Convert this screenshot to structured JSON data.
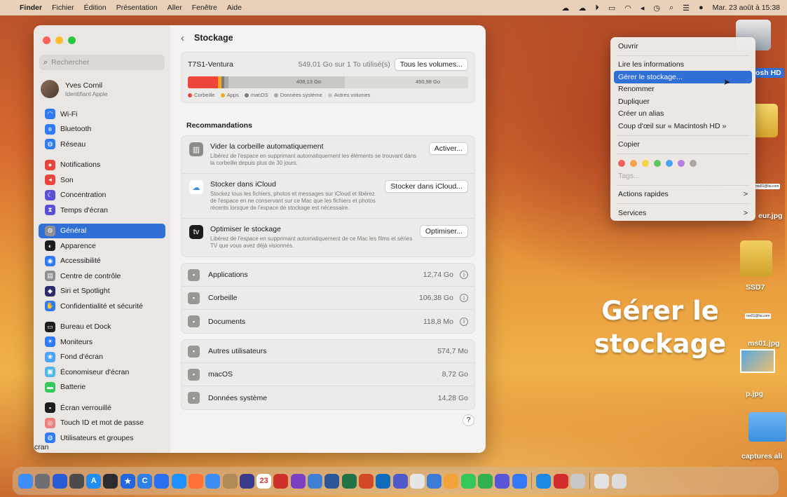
{
  "menubar": {
    "items": [
      "Finder",
      "Fichier",
      "Édition",
      "Présentation",
      "Aller",
      "Fenêtre",
      "Aide"
    ],
    "clock": "Mar. 23 août à 15:38"
  },
  "sidebar": {
    "search_placeholder": "Rechercher",
    "account_name": "Yves Cornil",
    "account_sub": "Identifiant Apple",
    "groups": [
      [
        {
          "label": "Wi-Fi",
          "color": "#2f7bf5",
          "icon": "wifi-icon"
        },
        {
          "label": "Bluetooth",
          "color": "#2f7bf5",
          "icon": "bluetooth-icon"
        },
        {
          "label": "Réseau",
          "color": "#2f7bf5",
          "icon": "globe-icon"
        }
      ],
      [
        {
          "label": "Notifications",
          "color": "#e8453c",
          "icon": "bell-icon"
        },
        {
          "label": "Son",
          "color": "#e8453c",
          "icon": "speaker-icon"
        },
        {
          "label": "Concentration",
          "color": "#5b4fd6",
          "icon": "moon-icon"
        },
        {
          "label": "Temps d'écran",
          "color": "#5b4fd6",
          "icon": "hourglass-icon"
        }
      ],
      [
        {
          "label": "Général",
          "color": "#8e8e93",
          "icon": "gear-icon"
        },
        {
          "label": "Apparence",
          "color": "#1d1d1f",
          "icon": "appearance-icon"
        },
        {
          "label": "Accessibilité",
          "color": "#2f7bf5",
          "icon": "accessibility-icon"
        },
        {
          "label": "Centre de contrôle",
          "color": "#8e8e93",
          "icon": "control-center-icon"
        },
        {
          "label": "Siri et Spotlight",
          "color": "#2b2b6e",
          "icon": "siri-icon"
        },
        {
          "label": "Confidentialité et sécurité",
          "color": "#2f7bf5",
          "icon": "hand-icon"
        }
      ],
      [
        {
          "label": "Bureau et Dock",
          "color": "#1d1d1f",
          "icon": "dock-icon"
        },
        {
          "label": "Moniteurs",
          "color": "#2f7bf5",
          "icon": "sun-icon"
        },
        {
          "label": "Fond d'écran",
          "color": "#4fa3f7",
          "icon": "wallpaper-icon"
        },
        {
          "label": "Économiseur d'écran",
          "color": "#52b6e8",
          "icon": "screensaver-icon"
        },
        {
          "label": "Batterie",
          "color": "#34c759",
          "icon": "battery-icon"
        }
      ],
      [
        {
          "label": "Écran verrouillé",
          "color": "#1d1d1f",
          "icon": "lock-icon"
        },
        {
          "label": "Touch ID et mot de passe",
          "color": "#f08080",
          "icon": "fingerprint-icon"
        },
        {
          "label": "Utilisateurs et groupes",
          "color": "#2f7bf5",
          "icon": "users-icon"
        }
      ]
    ],
    "selected": "Général",
    "fragment": "cran"
  },
  "main": {
    "title": "Stockage",
    "volume": {
      "name": "T7S1-Ventura",
      "usage": "549,01 Go sur 1 To utilisé(s)",
      "all_button": "Tous les volumes...",
      "bar_used_label": "406,13 Go",
      "bar_free_label": "450,98 Go",
      "segments": [
        {
          "name": "Corbeille",
          "color": "#f0453a",
          "fraction": 0.106
        },
        {
          "name": "Apps",
          "color": "#f5a623",
          "fraction": 0.013
        },
        {
          "name": "macOS",
          "color": "#7d7b78",
          "fraction": 0.009
        },
        {
          "name": "Données système",
          "color": "#a9a7a4",
          "fraction": 0.014
        },
        {
          "name": "Autres volumes",
          "color": "#c9c7c4",
          "fraction": 0.406
        }
      ],
      "legend": [
        "Corbeille",
        "Apps",
        "macOS",
        "Données système",
        "Autres volumes"
      ]
    },
    "recommendations_title": "Recommandations",
    "recommendations": [
      {
        "title": "Vider la corbeille automatiquement",
        "desc": "Libérez de l'espace en supprimant automatiquement les éléments se trouvant dans la corbeille depuis plus de 30 jours.",
        "button": "Activer...",
        "icon": "trash-icon",
        "icon_color": "#8e8c89"
      },
      {
        "title": "Stocker dans iCloud",
        "desc": "Stockez tous les fichiers, photos et messages sur iCloud et libérez de l'espace en ne conservant sur ce Mac que les fichiers et photos récents lorsque de l'espace de stockage est nécessaire.",
        "button": "Stocker dans iCloud...",
        "icon": "cloud-icon",
        "icon_color": "#ffffff"
      },
      {
        "title": "Optimiser le stockage",
        "desc": "Libérez de l'espace en supprimant automatiquement de ce Mac les films et séries TV que vous avez déjà visionnés.",
        "button": "Optimiser...",
        "icon": "appletv-icon",
        "icon_color": "#1d1d1f"
      }
    ],
    "categories_a": [
      {
        "label": "Applications",
        "size": "12,74 Go",
        "icon": "applications-icon"
      },
      {
        "label": "Corbeille",
        "size": "106,38 Go",
        "icon": "trash-icon"
      },
      {
        "label": "Documents",
        "size": "118,8 Mo",
        "icon": "document-icon"
      }
    ],
    "categories_b": [
      {
        "label": "Autres utilisateurs",
        "size": "574,7 Mo",
        "icon": "users-icon"
      },
      {
        "label": "macOS",
        "size": "8,72 Go",
        "icon": "macos-icon"
      },
      {
        "label": "Données système",
        "size": "14,28 Go",
        "icon": "system-data-icon"
      }
    ],
    "help": "?"
  },
  "context_menu": {
    "items_a": [
      "Ouvrir"
    ],
    "items_b": [
      "Lire les informations",
      "Gérer le stockage...",
      "Renommer",
      "Dupliquer",
      "Créer un alias",
      "Coup d'œil sur « Macintosh HD »"
    ],
    "items_c": [
      "Copier"
    ],
    "tags_label": "Tags...",
    "tag_colors": [
      "#f0615a",
      "#f5a54a",
      "#f5d34a",
      "#5ac85a",
      "#4aa3f5",
      "#b57ee0",
      "#a9a7a4"
    ],
    "items_d": [
      {
        "label": "Actions rapides",
        "arrow": ">"
      },
      {
        "label": "Services",
        "arrow": ">"
      }
    ],
    "selected": "Gérer le stockage..."
  },
  "desktop": {
    "macintosh_label": "osh HD",
    "ssd7_label": "SSD7",
    "jpg1_label": "eur.jpg",
    "jpg2_label": "ms01.jpg",
    "jpg3_label": "p.jpg",
    "folder_label": "captures ali",
    "mini1": "ms01@fai.com",
    "mini2": "ms01@fai.com",
    "overlay_line1": "Gérer le",
    "overlay_line2": "stockage"
  },
  "dock": {
    "apps": [
      {
        "name": "finder",
        "color": "#3e8ef7",
        "glyph": ""
      },
      {
        "name": "launchpad",
        "color": "#6e6e73",
        "glyph": ""
      },
      {
        "name": "app-grid",
        "color": "#2a5bd7",
        "glyph": ""
      },
      {
        "name": "safari-gray",
        "color": "#4b4b4b",
        "glyph": ""
      },
      {
        "name": "app-store",
        "color": "#1f8ef1",
        "glyph": "A"
      },
      {
        "name": "speedometer",
        "color": "#2c2c2e",
        "glyph": ""
      },
      {
        "name": "star-app",
        "color": "#2266dd",
        "glyph": "★"
      },
      {
        "name": "browser-c",
        "color": "#2f7fe6",
        "glyph": "C"
      },
      {
        "name": "browser-2",
        "color": "#2a6ff0",
        "glyph": ""
      },
      {
        "name": "safari",
        "color": "#1e90ff",
        "glyph": ""
      },
      {
        "name": "firefox",
        "color": "#ff7139",
        "glyph": ""
      },
      {
        "name": "mail",
        "color": "#3c8ef5",
        "glyph": ""
      },
      {
        "name": "contacts",
        "color": "#b08957",
        "glyph": ""
      },
      {
        "name": "app-dark",
        "color": "#3a3a8a",
        "glyph": ""
      },
      {
        "name": "calendar",
        "color": "#ffffff",
        "glyph": "23"
      },
      {
        "name": "app-red",
        "color": "#d0302a",
        "glyph": ""
      },
      {
        "name": "app-bars",
        "color": "#7b3fc4",
        "glyph": ""
      },
      {
        "name": "preview",
        "color": "#3f7fd6",
        "glyph": ""
      },
      {
        "name": "word",
        "color": "#2b579a",
        "glyph": ""
      },
      {
        "name": "excel",
        "color": "#217346",
        "glyph": ""
      },
      {
        "name": "powerpoint",
        "color": "#d24726",
        "glyph": ""
      },
      {
        "name": "outlook",
        "color": "#0f6cbd",
        "glyph": ""
      },
      {
        "name": "teams",
        "color": "#5059c9",
        "glyph": ""
      },
      {
        "name": "pen-app",
        "color": "#e6e6e6",
        "glyph": ""
      },
      {
        "name": "screen-app",
        "color": "#3a7bd5",
        "glyph": ""
      },
      {
        "name": "photos",
        "color": "#f2a33a",
        "glyph": ""
      },
      {
        "name": "messages",
        "color": "#34c759",
        "glyph": ""
      },
      {
        "name": "facetime",
        "color": "#30b04f",
        "glyph": ""
      },
      {
        "name": "app-purple",
        "color": "#5856d6",
        "glyph": ""
      },
      {
        "name": "app-blue",
        "color": "#3478f6",
        "glyph": ""
      },
      {
        "name": "app-cloud",
        "color": "#1e88e5",
        "glyph": ""
      },
      {
        "name": "acrobat",
        "color": "#d22d2d",
        "glyph": ""
      },
      {
        "name": "app-shadow",
        "color": "#c8c8c8",
        "glyph": ""
      },
      {
        "name": "app-image",
        "color": "#e3e3e3",
        "glyph": ""
      },
      {
        "name": "trash",
        "color": "#dcdcdc",
        "glyph": ""
      }
    ]
  }
}
